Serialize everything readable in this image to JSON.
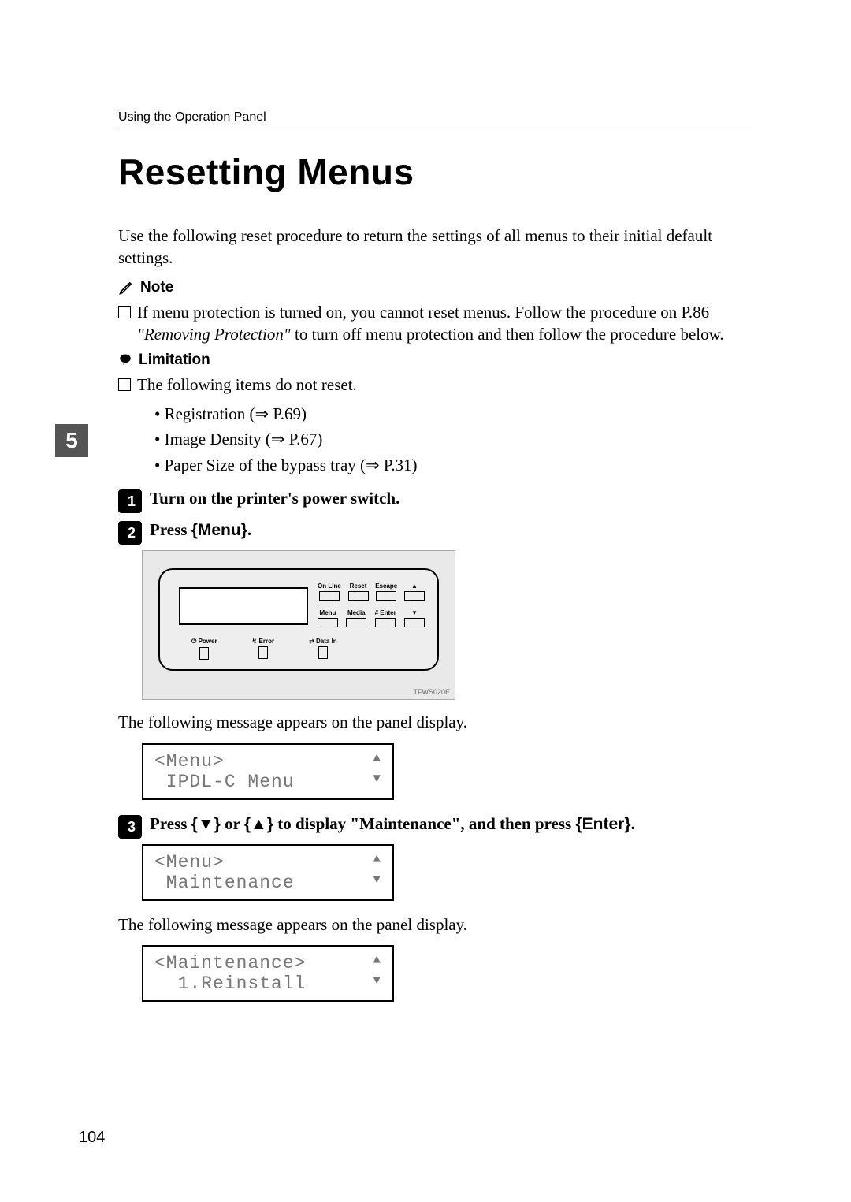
{
  "running_head": "Using the Operation Panel",
  "title": "Resetting Menus",
  "intro": "Use the following reset procedure to return the settings of all menus to their initial default settings.",
  "note_label": "Note",
  "note_item_pre": "If menu protection is turned on, you cannot reset menus. Follow the procedure on P.86 ",
  "note_item_ital": "\"Removing Protection\"",
  "note_item_post": " to turn off menu protection and then follow the procedure below.",
  "limitation_label": "Limitation",
  "limitation_intro": "The following items do not reset.",
  "bullets": {
    "b1": "Registration (⇒ P.69)",
    "b2": "Image Density (⇒ P.67)",
    "b3": "Paper Size of the bypass tray (⇒ P.31)"
  },
  "side_tab": "5",
  "steps": {
    "s1": "Turn on the printer's power switch.",
    "s2_pre": "Press ",
    "s2_key": "Menu",
    "s2_post": ".",
    "s3_pre": "Press ",
    "s3_key1": "▼",
    "s3_mid": " or ",
    "s3_key2": "▲",
    "s3_mid2": " to display \"Maintenance\", and then press ",
    "s3_key3": "Enter",
    "s3_post": "."
  },
  "panel": {
    "btns_top": [
      "On Line",
      "Reset",
      "Escape",
      "▲"
    ],
    "btns_bot": [
      "Menu",
      "Media",
      "# Enter",
      "▼"
    ],
    "leds": [
      "Power",
      "Error",
      "Data In"
    ],
    "caption": "TFWS020E"
  },
  "after_panel_msg": "The following message appears on the panel display.",
  "lcd1": {
    "l1": "<Menu>",
    "l2": " IPDL-C Menu"
  },
  "lcd2": {
    "l1": "<Menu>",
    "l2": " Maintenance"
  },
  "after_lcd2_msg": "The following message appears on the panel display.",
  "lcd3": {
    "l1": "<Maintenance>",
    "l2": "  1.Reinstall"
  },
  "page_number": "104",
  "step_numbers": {
    "n1": "1",
    "n2": "2",
    "n3": "3"
  }
}
